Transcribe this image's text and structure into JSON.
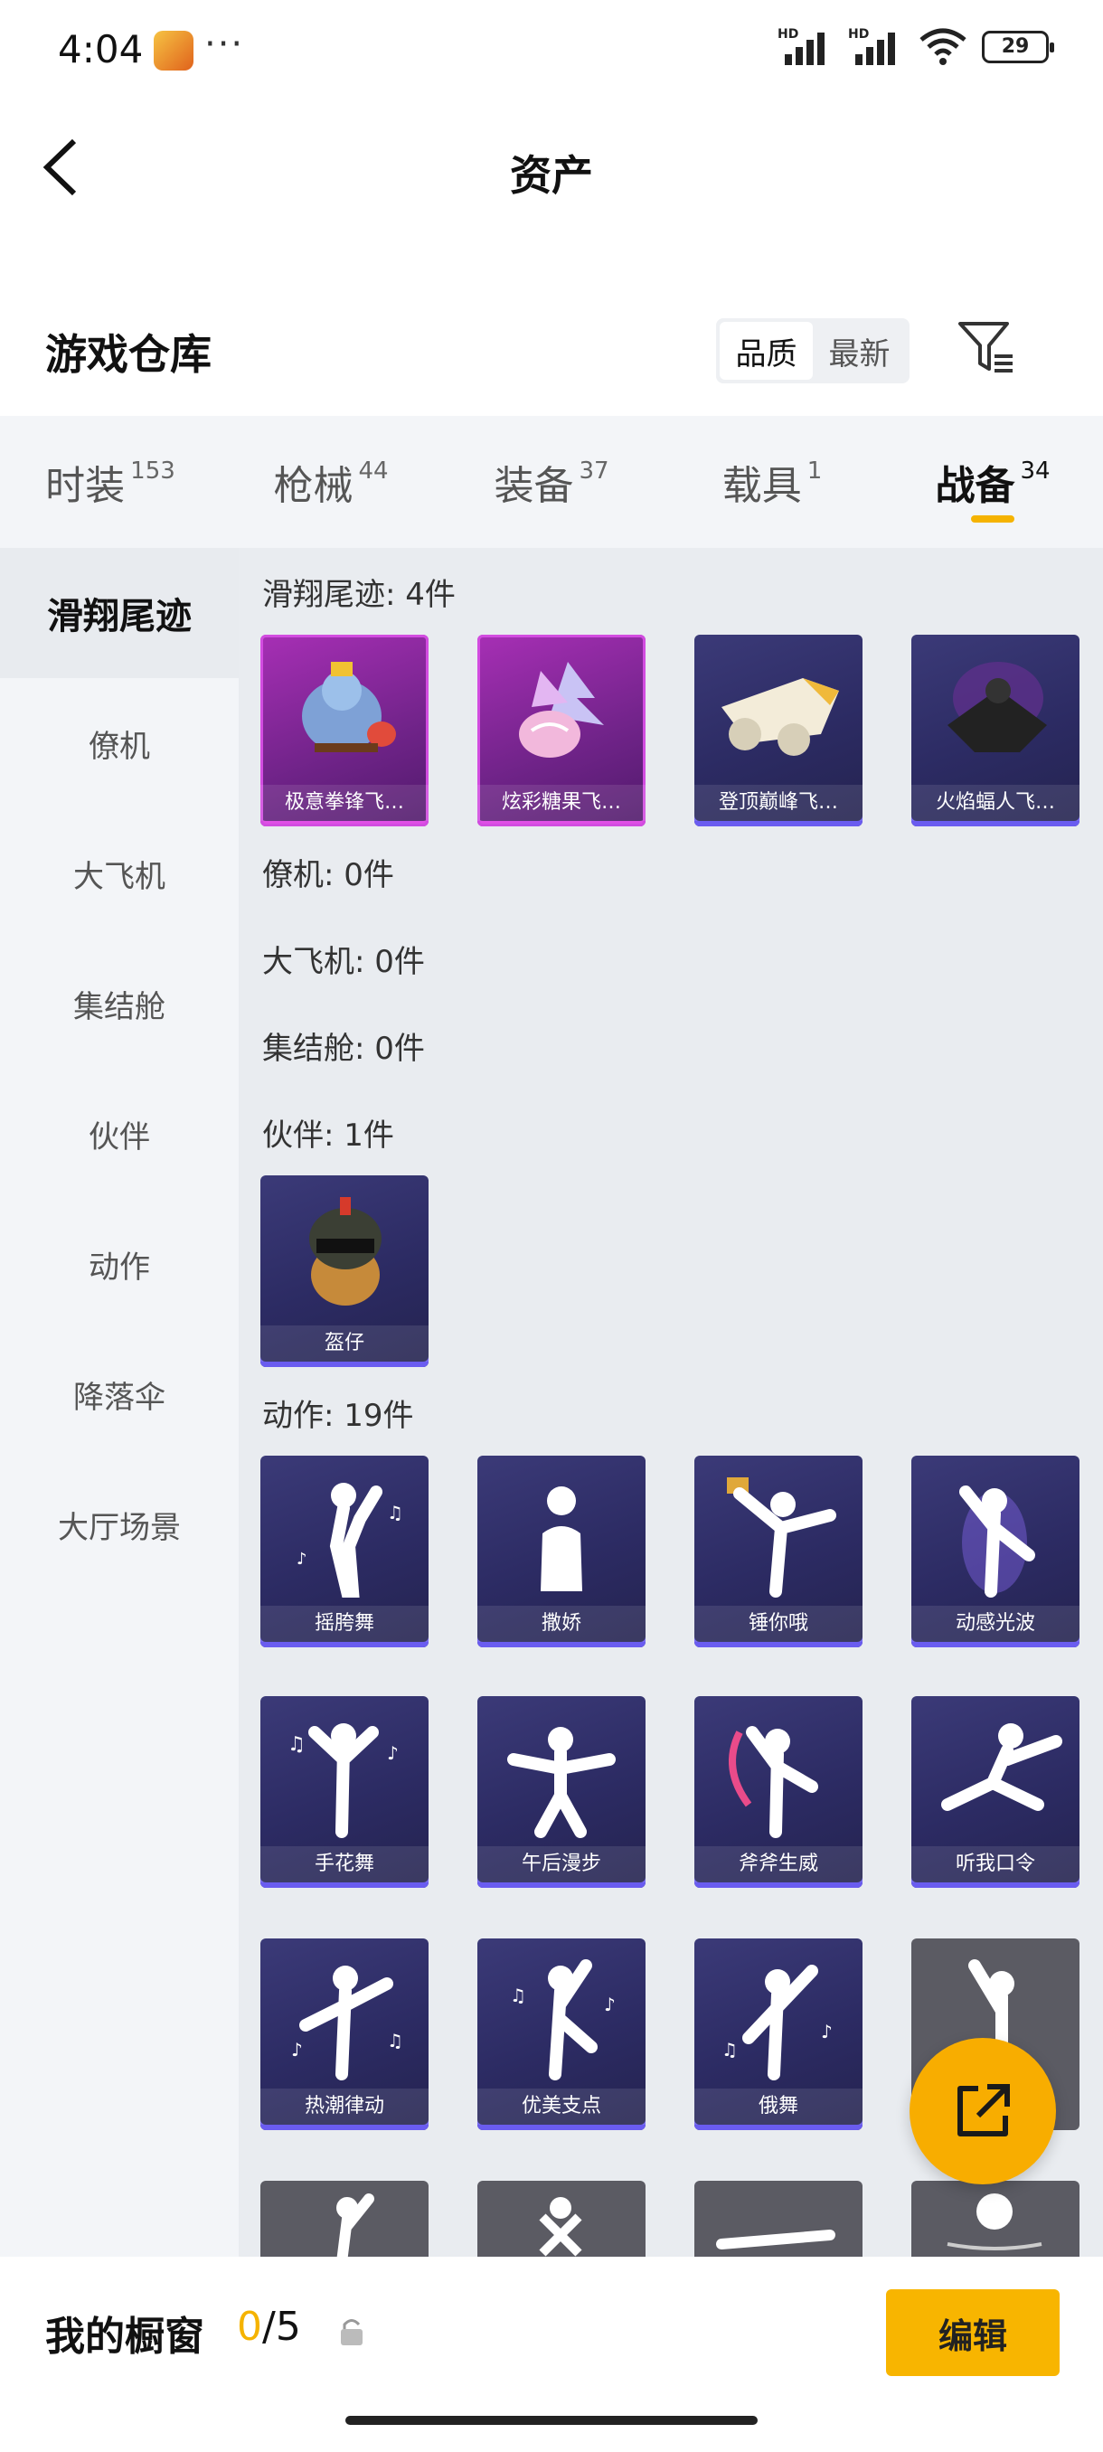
{
  "status_bar": {
    "time": "4:04",
    "dots": "···",
    "battery": "29"
  },
  "header": {
    "title": "资产"
  },
  "warehouse": {
    "title": "游戏仓库",
    "sort_options": [
      "品质",
      "最新"
    ],
    "active_sort": 0
  },
  "tabs": [
    {
      "label": "时装",
      "count": "153"
    },
    {
      "label": "枪械",
      "count": "44"
    },
    {
      "label": "装备",
      "count": "37"
    },
    {
      "label": "载具",
      "count": "1"
    },
    {
      "label": "战备",
      "count": "34"
    }
  ],
  "active_tab": 4,
  "sidebar": {
    "items": [
      "滑翔尾迹",
      "僚机",
      "大飞机",
      "集结舱",
      "伙伴",
      "动作",
      "降落伞",
      "大厅场景"
    ],
    "active": 0
  },
  "sections": {
    "glide": {
      "title": "滑翔尾迹: 4件",
      "items": [
        "极意拳锋飞…",
        "炫彩糖果飞…",
        "登顶巅峰飞…",
        "火焰蝠人飞…"
      ]
    },
    "wingman": {
      "title": "僚机: 0件"
    },
    "plane": {
      "title": "大飞机: 0件"
    },
    "pod": {
      "title": "集结舱: 0件"
    },
    "partner": {
      "title": "伙伴: 1件",
      "items": [
        "盔仔"
      ]
    },
    "emotes": {
      "title": "动作: 19件",
      "items": [
        "摇胯舞",
        "撒娇",
        "锤你哦",
        "动感光波",
        "手花舞",
        "午后漫步",
        "斧斧生威",
        "听我口令",
        "热潮律动",
        "优美支点",
        "俄舞"
      ]
    }
  },
  "bottom_bar": {
    "label": "我的橱窗",
    "current": "0",
    "total": "/5",
    "edit_label": "编辑"
  },
  "colors": {
    "accent": "#f5b301",
    "card_purple": "#2c2b63",
    "card_pink": "#a72fb5",
    "card_grey": "#5b5b63"
  }
}
